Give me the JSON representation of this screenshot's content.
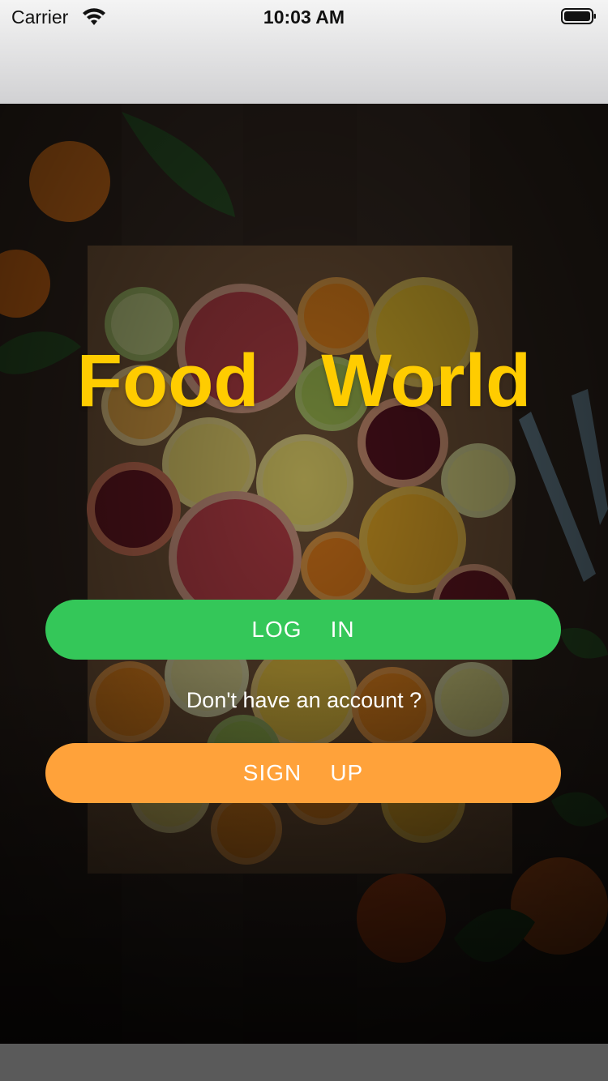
{
  "status_bar": {
    "carrier": "Carrier",
    "time": "10:03 AM",
    "wifi_icon": "wifi-icon",
    "battery_icon": "battery-icon"
  },
  "app": {
    "title": "Food   World",
    "title_color": "#ffcc00"
  },
  "actions": {
    "login_label": "LOG    IN",
    "login_color": "#34c759",
    "signup_prompt": "Don't have an account ?",
    "signup_label": "SIGN    UP",
    "signup_color": "#ffa23a"
  }
}
